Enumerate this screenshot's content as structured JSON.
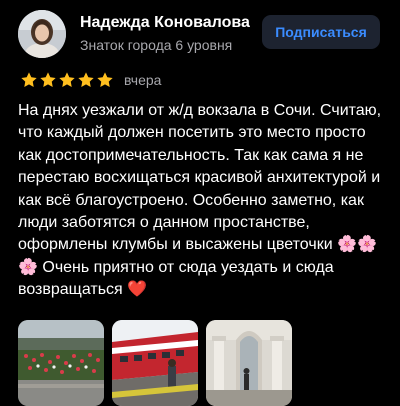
{
  "review": {
    "author": {
      "name": "Надежда Коновалова",
      "rank": "Знаток города 6 уровня"
    },
    "subscribe_label": "Подписаться",
    "rating": 5,
    "date": "вчера",
    "text": "На днях уезжали от ж/д вокзала в Сочи. Считаю, что каждый должен посетить это место просто как достопримечательность. Так как сама я не перестаю восхищаться красивой анхитектурой и как всё благоустроено. Особенно заметно, как люди заботятся о данном простанстве, оформлены клумбы и высажены цветочки 🌸🌸🌸 Очень приятно от сюда уездать и сюда возвращаться ❤️",
    "photos": [
      "flower-bed-photo",
      "red-train-photo",
      "station-colonnade-photo"
    ]
  },
  "colors": {
    "background": "#000000",
    "accent_blue": "#3b8cff",
    "button_bg": "#1d2330",
    "star": "#ffbf1f",
    "muted": "#a8a8ad"
  },
  "icons": {
    "star": "star-icon"
  }
}
